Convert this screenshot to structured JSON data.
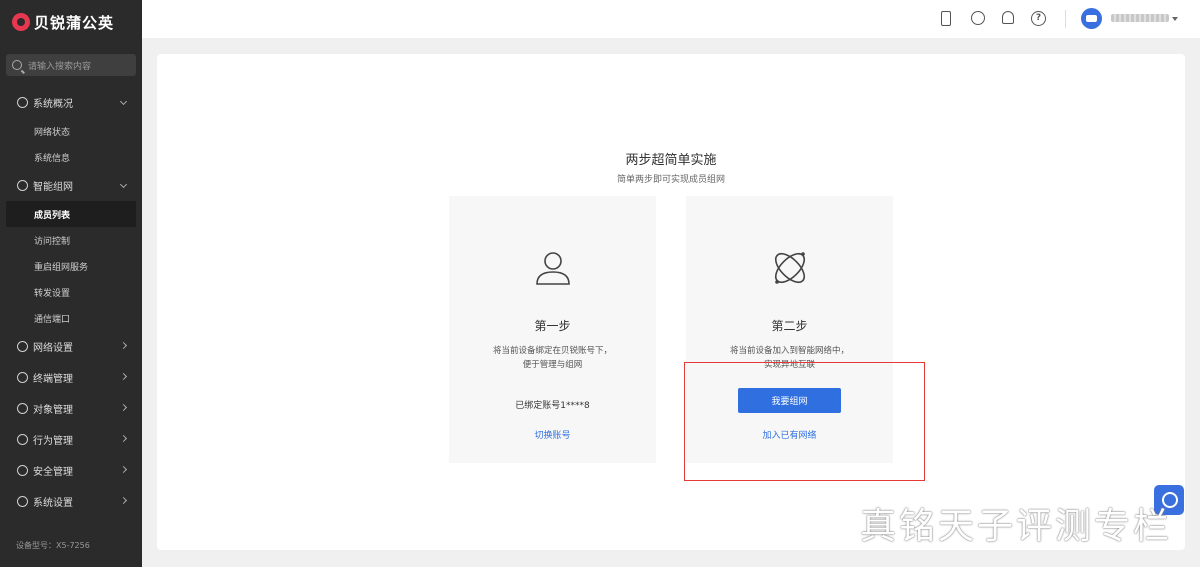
{
  "app": {
    "logo_text": "贝锐蒲公英"
  },
  "search": {
    "placeholder": "请输入搜索内容"
  },
  "sidebar": {
    "groups": [
      {
        "label": "系统概况",
        "icon": "globe-icon",
        "expanded": true,
        "items": [
          "网络状态",
          "系统信息"
        ]
      },
      {
        "label": "智能组网",
        "icon": "network-icon",
        "expanded": true,
        "items": [
          "成员列表",
          "访问控制",
          "重启组网服务",
          "转发设置",
          "通信端口"
        ],
        "active_item": "成员列表"
      },
      {
        "label": "网络设置",
        "icon": "sliders-icon",
        "expanded": false
      },
      {
        "label": "终端管理",
        "icon": "terminal-icon",
        "expanded": false
      },
      {
        "label": "对象管理",
        "icon": "folder-icon",
        "expanded": false
      },
      {
        "label": "行为管理",
        "icon": "behavior-icon",
        "expanded": false
      },
      {
        "label": "安全管理",
        "icon": "shield-icon",
        "expanded": false
      },
      {
        "label": "系统设置",
        "icon": "gear-icon",
        "expanded": false
      }
    ],
    "device_model": "设备型号：X5-7256"
  },
  "header": {
    "icons": [
      "phone-icon",
      "robot-icon",
      "bell-icon",
      "help-icon"
    ]
  },
  "main": {
    "title": "两步超简单实施",
    "subtitle": "简单两步即可实现成员组网",
    "step1": {
      "name": "第一步",
      "desc_line1": "将当前设备绑定在贝锐账号下，",
      "desc_line2": "便于管理与组网",
      "bound_text": "已绑定账号1****8",
      "link": "切换账号"
    },
    "step2": {
      "name": "第二步",
      "desc_line1": "将当前设备加入到智能网络中，",
      "desc_line2": "实现异地互联",
      "button": "我要组网",
      "link": "加入已有网络"
    }
  },
  "watermark": "真铭天子评测专栏",
  "colors": {
    "accent": "#2f6fe0",
    "sidebar_bg": "#2b2b2b",
    "highlight_box": "#e53935",
    "logo": "#e8384f"
  }
}
